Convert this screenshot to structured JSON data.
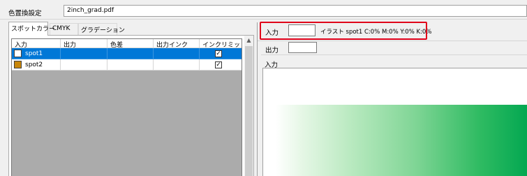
{
  "header": {
    "title": "色置換設定",
    "file_name": "2inch_grad.pdf"
  },
  "tabs": [
    {
      "label": "スポットカラー",
      "active": true
    },
    {
      "label": "CMYK",
      "active": false
    },
    {
      "label": "グラデーション",
      "active": false
    }
  ],
  "table": {
    "columns": [
      "入力",
      "出力",
      "色差",
      "出力インク",
      "インクリミット"
    ],
    "rows": [
      {
        "name": "spot1",
        "swatch_color": "#ffffff",
        "ink_limit_checked": true,
        "selected": true
      },
      {
        "name": "spot2",
        "swatch_color": "#c8860a",
        "ink_limit_checked": true,
        "selected": false
      }
    ]
  },
  "scrollbar": {
    "up_icon": "▲"
  },
  "right_panel": {
    "input_label": "入力",
    "input_value": "",
    "input_description": "イラスト spot1  C:0% M:0% Y:0% K:0%",
    "output_label": "出力",
    "output_value": "",
    "preview_label": "入力"
  },
  "colors": {
    "highlight": "#e0001a",
    "selection": "#0078d7",
    "gradient_end": "#00a650"
  }
}
